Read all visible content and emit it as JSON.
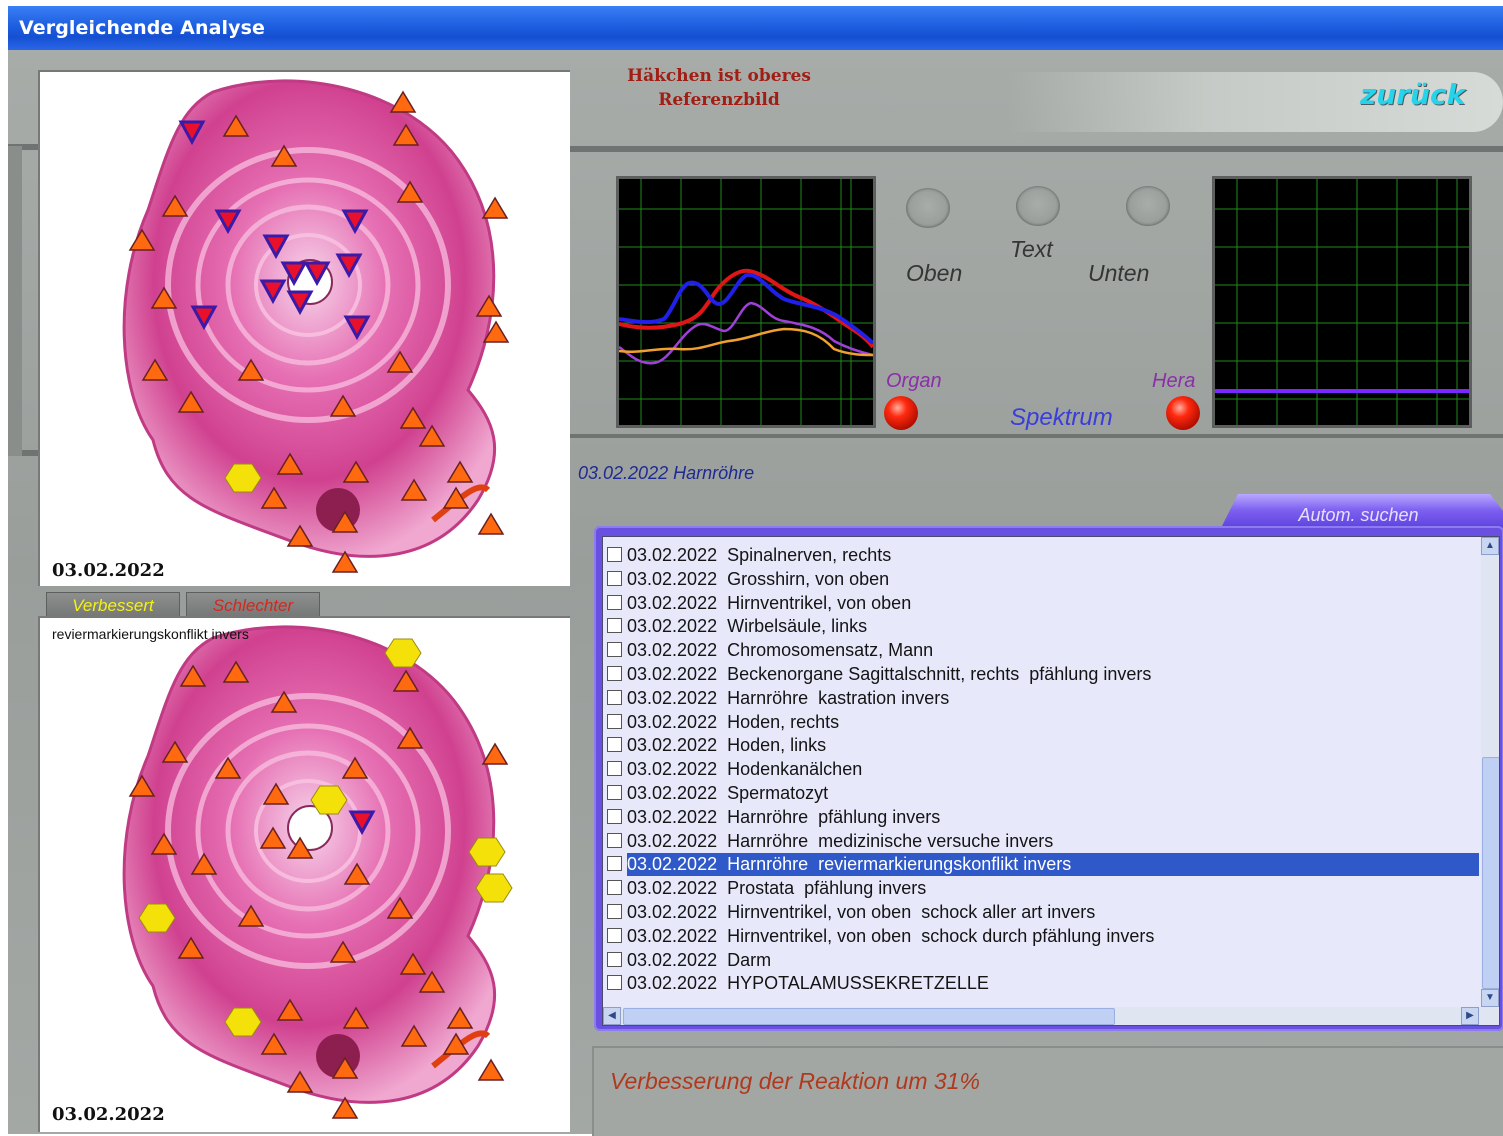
{
  "window": {
    "title": "Vergleichende Analyse"
  },
  "reference_images": [
    {
      "date": "03.02.2022",
      "caption": ""
    },
    {
      "date": "03.02.2022",
      "caption": "reviermarkierungskonflikt invers"
    }
  ],
  "tabs": [
    {
      "label": "Verbessert",
      "color": "#f5f019"
    },
    {
      "label": "Schlechter",
      "color": "#d2281e"
    }
  ],
  "hint": {
    "line1": "Häkchen ist oberes",
    "line2": "Referenzbild"
  },
  "back_button": {
    "label": "zurück"
  },
  "controls": {
    "knob_labels": [
      "Oben",
      "Text",
      "Unten"
    ],
    "organ_label": "Organ",
    "hera_label": "Hera",
    "spectrum_label": "Spektrum"
  },
  "selected_entry": "03.02.2022 Harnröhre",
  "search_button": {
    "label": "Autom. suchen"
  },
  "list": {
    "items": [
      {
        "date": "03.02.2022",
        "label": "Spinalnerven, rechts",
        "checked": false,
        "selected": false
      },
      {
        "date": "03.02.2022",
        "label": "Grosshirn, von oben",
        "checked": false,
        "selected": false
      },
      {
        "date": "03.02.2022",
        "label": "Hirnventrikel, von oben",
        "checked": false,
        "selected": false
      },
      {
        "date": "03.02.2022",
        "label": "Wirbelsäule, links",
        "checked": false,
        "selected": false
      },
      {
        "date": "03.02.2022",
        "label": "Chromosomensatz, Mann",
        "checked": false,
        "selected": false
      },
      {
        "date": "03.02.2022",
        "label": "Beckenorgane Sagittalschnitt, rechts  pfählung invers",
        "checked": false,
        "selected": false
      },
      {
        "date": "03.02.2022",
        "label": "Harnröhre  kastration invers",
        "checked": false,
        "selected": false
      },
      {
        "date": "03.02.2022",
        "label": "Hoden, rechts",
        "checked": false,
        "selected": false
      },
      {
        "date": "03.02.2022",
        "label": "Hoden, links",
        "checked": false,
        "selected": false
      },
      {
        "date": "03.02.2022",
        "label": "Hodenkanälchen",
        "checked": false,
        "selected": false
      },
      {
        "date": "03.02.2022",
        "label": "Spermatozyt",
        "checked": false,
        "selected": false
      },
      {
        "date": "03.02.2022",
        "label": "Harnröhre  pfählung invers",
        "checked": false,
        "selected": false
      },
      {
        "date": "03.02.2022",
        "label": "Harnröhre  medizinische versuche invers",
        "checked": false,
        "selected": false
      },
      {
        "date": "03.02.2022",
        "label": "Harnröhre  reviermarkierungskonflikt invers",
        "checked": false,
        "selected": true
      },
      {
        "date": "03.02.2022",
        "label": "Prostata  pfählung invers",
        "checked": false,
        "selected": false
      },
      {
        "date": "03.02.2022",
        "label": "Hirnventrikel, von oben  schock aller art invers",
        "checked": false,
        "selected": false
      },
      {
        "date": "03.02.2022",
        "label": "Hirnventrikel, von oben  schock durch pfählung invers",
        "checked": false,
        "selected": false
      },
      {
        "date": "03.02.2022",
        "label": "Darm",
        "checked": false,
        "selected": false
      },
      {
        "date": "03.02.2022",
        "label": "HYPOTALAMUSSEKRETZELLE",
        "checked": false,
        "selected": false
      }
    ]
  },
  "result": {
    "text": "Verbesserung der Reaktion um 31%"
  },
  "colors": {
    "titlebar": "#1d5fe0",
    "accent_back": "#25d3ea",
    "hint": "#a01e14",
    "selection": "#2f58c8",
    "result_text": "#b0391d",
    "curve_red": "#e01616",
    "curve_blue": "#2020e8",
    "curve_purple": "#a040d8",
    "curve_orange": "#f0a030",
    "baseline_purple": "#7a28ff"
  }
}
